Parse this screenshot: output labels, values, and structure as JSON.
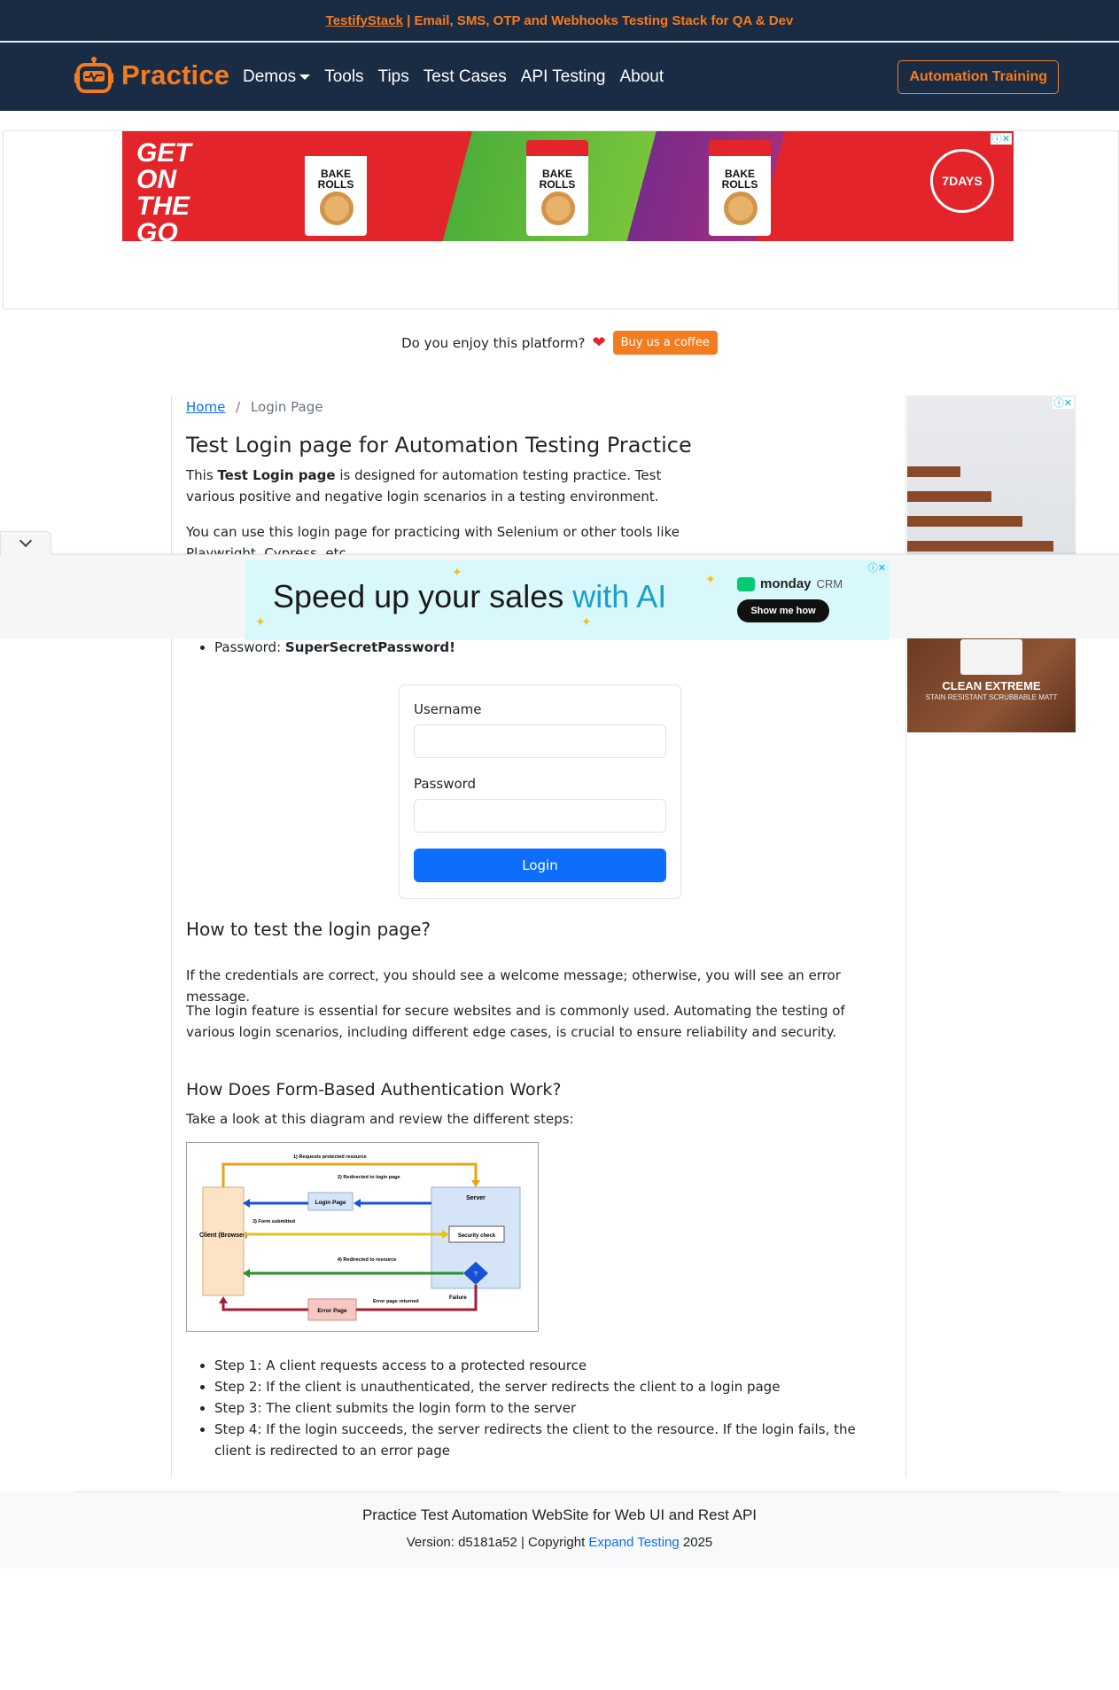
{
  "top_banner": {
    "link_text": "TestifyStack",
    "rest_text": " | Email, SMS, OTP and Webhooks Testing Stack for QA & Dev"
  },
  "navbar": {
    "brand": "Practice",
    "links": [
      {
        "label": "Demos"
      },
      {
        "label": "Tools"
      },
      {
        "label": "Tips"
      },
      {
        "label": "Test Cases"
      },
      {
        "label": "API Testing"
      },
      {
        "label": "About"
      }
    ],
    "cta": "Automation Training"
  },
  "top_ad": {
    "headline": "GET ON THE GO",
    "bags": [
      "BAKE ROLLS",
      "BAKE ROLLS",
      "BAKE ROLLS"
    ],
    "brand": "7DAYS"
  },
  "coffee": {
    "question": "Do you enjoy this platform?",
    "button": "Buy us a coffee"
  },
  "breadcrumb": {
    "home": "Home",
    "current": "Login Page"
  },
  "page": {
    "title": "Test Login page for Automation Testing Practice",
    "intro_prefix": "This ",
    "intro_bold": "Test Login page",
    "intro_suffix": " is designed for automation testing practice. Test various positive and negative login scenarios in a testing environment.",
    "tools_text": "You can use this login page for practicing with Selenium or other tools like Playwright, Cypress, etc.",
    "password_label": "Password: ",
    "password_value": "SuperSecretPassword!"
  },
  "login_form": {
    "username_label": "Username",
    "username_value": "",
    "password_label": "Password",
    "password_value": "",
    "button": "Login"
  },
  "how_to": {
    "heading": "How to test the login page?",
    "p1": "If the credentials are correct, you should see a welcome message; otherwise, you will see an error message.",
    "p2": "The login feature is essential for secure websites and is commonly used. Automating the testing of various login scenarios, including different edge cases, is crucial to ensure reliability and security."
  },
  "form_auth": {
    "heading": "How Does Form-Based Authentication Work?",
    "intro": "Take a look at this diagram and review the different steps:",
    "diagram": {
      "client": "Client (Browser)",
      "server": "Server",
      "login_page": "Login Page",
      "security_check": "Security check",
      "decision": "?",
      "error_page": "Error Page",
      "failure": "Failure",
      "arrow1": "1) Requests protected resource",
      "arrow2": "2) Redirected to login page",
      "arrow3": "3) Form submitted",
      "arrow4": "4) Redirected to resource",
      "arrow5": "Error page returned"
    },
    "steps": [
      "Step 1: A client requests access to a protected resource",
      "Step 2: If the client is unauthenticated, the server redirects the client to a login page",
      "Step 3: The client submits the login form to the server",
      "Step 4: If the login succeeds, the server redirects the client to the resource. If the login fails, the client is redirected to an error page"
    ]
  },
  "side_ad": {
    "product": "CLEAN EXTREME",
    "sub": "STAIN RESISTANT SCRUBBABLE MATT"
  },
  "overlay_ad": {
    "headline_prefix": "Speed up your sales ",
    "headline_ai": "with AI",
    "brand": "monday",
    "brand_suffix": "CRM",
    "button": "Show me how"
  },
  "footer": {
    "title": "Practice Test Automation WebSite for Web UI and Rest API",
    "copy_prefix": "Version: d5181a52 | Copyright ",
    "copy_link": "Expand Testing",
    "copy_year": " 2025"
  },
  "colors": {
    "navy": "#1a2b44",
    "orange": "#f47c20",
    "primary": "#0d6efd"
  }
}
